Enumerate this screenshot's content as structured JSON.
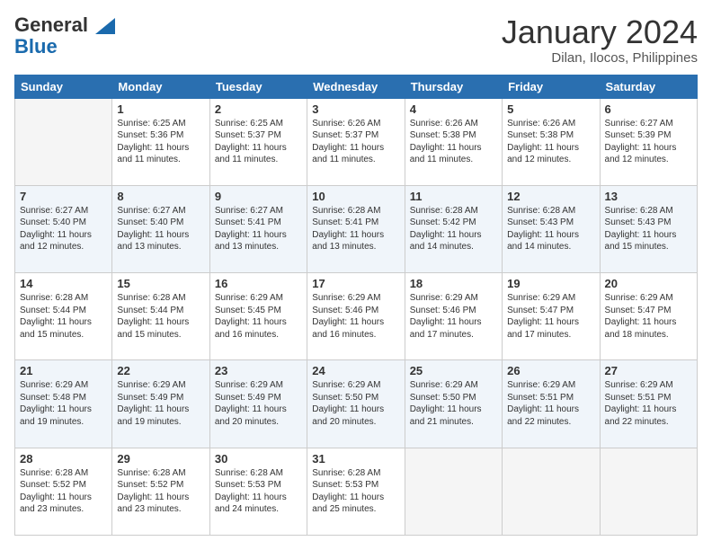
{
  "logo": {
    "line1": "General",
    "line2": "Blue"
  },
  "header": {
    "month": "January 2024",
    "location": "Dilan, Ilocos, Philippines"
  },
  "weekdays": [
    "Sunday",
    "Monday",
    "Tuesday",
    "Wednesday",
    "Thursday",
    "Friday",
    "Saturday"
  ],
  "weeks": [
    [
      {
        "day": "",
        "info": ""
      },
      {
        "day": "1",
        "info": "Sunrise: 6:25 AM\nSunset: 5:36 PM\nDaylight: 11 hours\nand 11 minutes."
      },
      {
        "day": "2",
        "info": "Sunrise: 6:25 AM\nSunset: 5:37 PM\nDaylight: 11 hours\nand 11 minutes."
      },
      {
        "day": "3",
        "info": "Sunrise: 6:26 AM\nSunset: 5:37 PM\nDaylight: 11 hours\nand 11 minutes."
      },
      {
        "day": "4",
        "info": "Sunrise: 6:26 AM\nSunset: 5:38 PM\nDaylight: 11 hours\nand 11 minutes."
      },
      {
        "day": "5",
        "info": "Sunrise: 6:26 AM\nSunset: 5:38 PM\nDaylight: 11 hours\nand 12 minutes."
      },
      {
        "day": "6",
        "info": "Sunrise: 6:27 AM\nSunset: 5:39 PM\nDaylight: 11 hours\nand 12 minutes."
      }
    ],
    [
      {
        "day": "7",
        "info": "Sunrise: 6:27 AM\nSunset: 5:40 PM\nDaylight: 11 hours\nand 12 minutes."
      },
      {
        "day": "8",
        "info": "Sunrise: 6:27 AM\nSunset: 5:40 PM\nDaylight: 11 hours\nand 13 minutes."
      },
      {
        "day": "9",
        "info": "Sunrise: 6:27 AM\nSunset: 5:41 PM\nDaylight: 11 hours\nand 13 minutes."
      },
      {
        "day": "10",
        "info": "Sunrise: 6:28 AM\nSunset: 5:41 PM\nDaylight: 11 hours\nand 13 minutes."
      },
      {
        "day": "11",
        "info": "Sunrise: 6:28 AM\nSunset: 5:42 PM\nDaylight: 11 hours\nand 14 minutes."
      },
      {
        "day": "12",
        "info": "Sunrise: 6:28 AM\nSunset: 5:43 PM\nDaylight: 11 hours\nand 14 minutes."
      },
      {
        "day": "13",
        "info": "Sunrise: 6:28 AM\nSunset: 5:43 PM\nDaylight: 11 hours\nand 15 minutes."
      }
    ],
    [
      {
        "day": "14",
        "info": "Sunrise: 6:28 AM\nSunset: 5:44 PM\nDaylight: 11 hours\nand 15 minutes."
      },
      {
        "day": "15",
        "info": "Sunrise: 6:28 AM\nSunset: 5:44 PM\nDaylight: 11 hours\nand 15 minutes."
      },
      {
        "day": "16",
        "info": "Sunrise: 6:29 AM\nSunset: 5:45 PM\nDaylight: 11 hours\nand 16 minutes."
      },
      {
        "day": "17",
        "info": "Sunrise: 6:29 AM\nSunset: 5:46 PM\nDaylight: 11 hours\nand 16 minutes."
      },
      {
        "day": "18",
        "info": "Sunrise: 6:29 AM\nSunset: 5:46 PM\nDaylight: 11 hours\nand 17 minutes."
      },
      {
        "day": "19",
        "info": "Sunrise: 6:29 AM\nSunset: 5:47 PM\nDaylight: 11 hours\nand 17 minutes."
      },
      {
        "day": "20",
        "info": "Sunrise: 6:29 AM\nSunset: 5:47 PM\nDaylight: 11 hours\nand 18 minutes."
      }
    ],
    [
      {
        "day": "21",
        "info": "Sunrise: 6:29 AM\nSunset: 5:48 PM\nDaylight: 11 hours\nand 19 minutes."
      },
      {
        "day": "22",
        "info": "Sunrise: 6:29 AM\nSunset: 5:49 PM\nDaylight: 11 hours\nand 19 minutes."
      },
      {
        "day": "23",
        "info": "Sunrise: 6:29 AM\nSunset: 5:49 PM\nDaylight: 11 hours\nand 20 minutes."
      },
      {
        "day": "24",
        "info": "Sunrise: 6:29 AM\nSunset: 5:50 PM\nDaylight: 11 hours\nand 20 minutes."
      },
      {
        "day": "25",
        "info": "Sunrise: 6:29 AM\nSunset: 5:50 PM\nDaylight: 11 hours\nand 21 minutes."
      },
      {
        "day": "26",
        "info": "Sunrise: 6:29 AM\nSunset: 5:51 PM\nDaylight: 11 hours\nand 22 minutes."
      },
      {
        "day": "27",
        "info": "Sunrise: 6:29 AM\nSunset: 5:51 PM\nDaylight: 11 hours\nand 22 minutes."
      }
    ],
    [
      {
        "day": "28",
        "info": "Sunrise: 6:28 AM\nSunset: 5:52 PM\nDaylight: 11 hours\nand 23 minutes."
      },
      {
        "day": "29",
        "info": "Sunrise: 6:28 AM\nSunset: 5:52 PM\nDaylight: 11 hours\nand 23 minutes."
      },
      {
        "day": "30",
        "info": "Sunrise: 6:28 AM\nSunset: 5:53 PM\nDaylight: 11 hours\nand 24 minutes."
      },
      {
        "day": "31",
        "info": "Sunrise: 6:28 AM\nSunset: 5:53 PM\nDaylight: 11 hours\nand 25 minutes."
      },
      {
        "day": "",
        "info": ""
      },
      {
        "day": "",
        "info": ""
      },
      {
        "day": "",
        "info": ""
      }
    ]
  ]
}
